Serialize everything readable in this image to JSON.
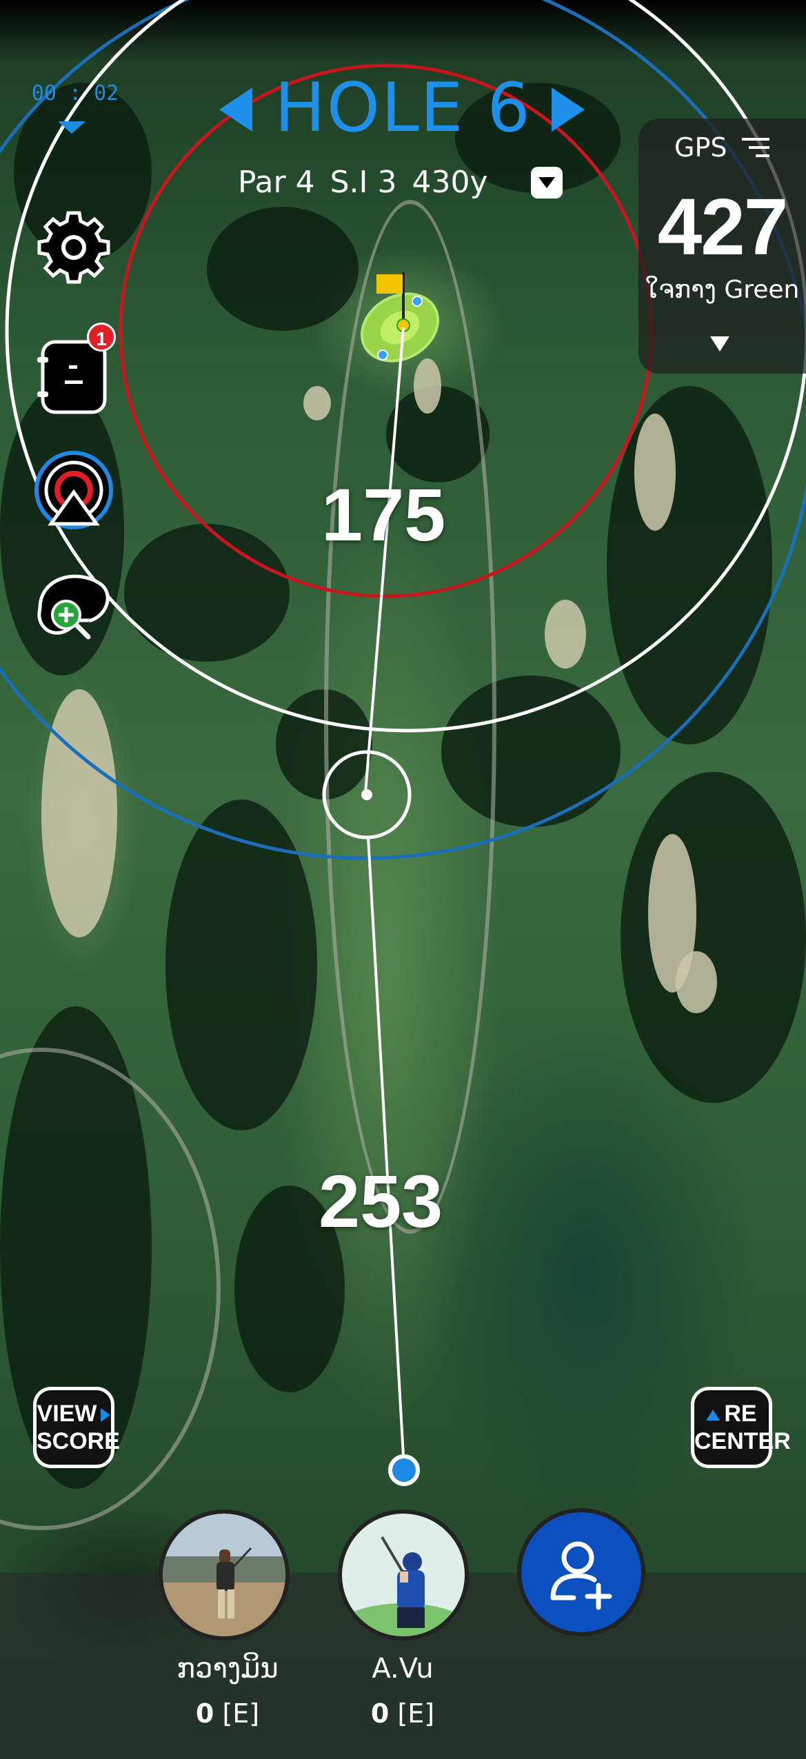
{
  "timer": "00 : 02",
  "hole": {
    "title": "HOLE 6",
    "par": "Par 4",
    "stroke_index": "S.I 3",
    "length": "430y"
  },
  "gps": {
    "label": "GPS",
    "distance": "427",
    "target": "ໃຈກາງ Green"
  },
  "tools": {
    "notes_badge": "1"
  },
  "map": {
    "distance_to_green": "175",
    "distance_from_tee": "253"
  },
  "buttons": {
    "view_score_line1": "VIEW",
    "view_score_line2": "SCORE",
    "recenter_line1": "RE",
    "recenter_line2": "CENTER"
  },
  "players": [
    {
      "name": "ກວາງມິນ",
      "score": "0",
      "relative": "[E]"
    },
    {
      "name": "A.Vu",
      "score": "0",
      "relative": "[E]"
    }
  ],
  "colors": {
    "accent_blue": "#1e90ea",
    "ring_red": "#c8161e",
    "ring_blue": "#1a6fb8",
    "add_player_blue": "#0c4fbf",
    "badge_red": "#e01e26",
    "flag_yellow": "#f5c400"
  },
  "icons": {
    "settings": "gear-icon",
    "notes": "notebook-icon",
    "target": "target-rings-icon",
    "zoom": "zoom-plus-icon",
    "add_player": "add-user-icon"
  }
}
